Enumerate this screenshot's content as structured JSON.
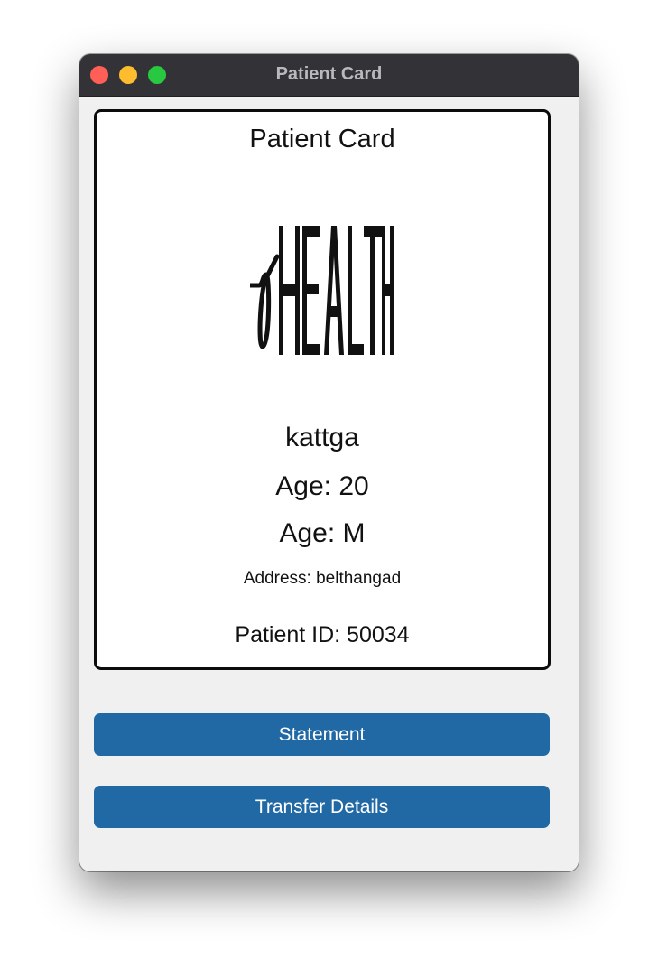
{
  "window": {
    "title": "Patient Card"
  },
  "card": {
    "title": "Patient Card",
    "logo_text": "HEALTH",
    "name": "kattga",
    "age": "Age: 20",
    "gender": "Age: M",
    "address": "Address: belthangad",
    "patient_id": "Patient ID: 50034"
  },
  "buttons": {
    "statement": "Statement",
    "transfer": "Transfer Details"
  },
  "colors": {
    "button_bg": "#2069a5",
    "titlebar_bg": "#323237",
    "close": "#ff5f57",
    "minimize": "#febc2e",
    "zoom": "#28c840"
  }
}
